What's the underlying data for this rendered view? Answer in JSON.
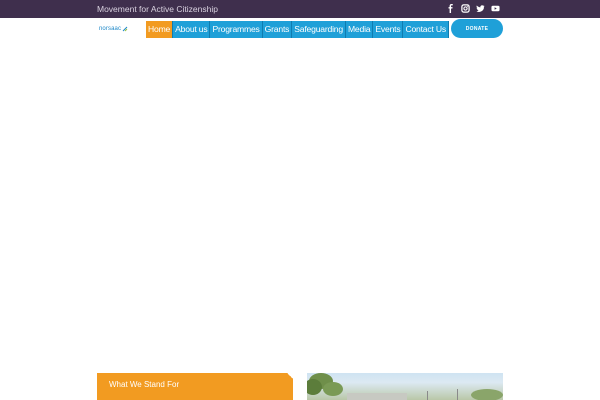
{
  "topbar": {
    "tagline": "Movement for Active Citizenship",
    "socials": [
      "facebook-icon",
      "instagram-icon",
      "twitter-icon",
      "youtube-icon"
    ]
  },
  "logo": {
    "text": "norsaac"
  },
  "nav": {
    "items": [
      {
        "label": "Home",
        "active": true
      },
      {
        "label": "About us"
      },
      {
        "label": "Programmes"
      },
      {
        "label": "Grants"
      },
      {
        "label": "Safeguarding"
      },
      {
        "label": "Media"
      },
      {
        "label": "Events"
      },
      {
        "label": "Contact Us"
      }
    ]
  },
  "donate_label": "DONATE",
  "stand": {
    "title": "What We Stand For"
  },
  "colors": {
    "topbar": "#3f2f4d",
    "nav": "#1fa0d8",
    "accent": "#f29b21"
  }
}
